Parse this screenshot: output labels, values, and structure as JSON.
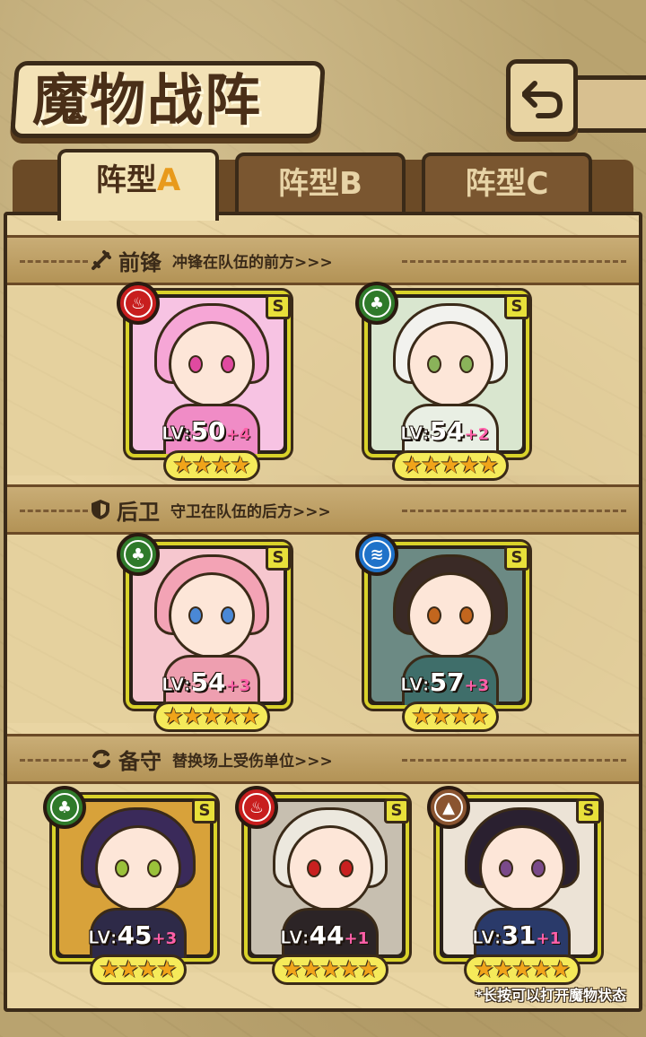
{
  "header": {
    "title": "魔物战阵",
    "back_icon": "return-arrow-icon"
  },
  "tabs": [
    {
      "label_main": "阵型",
      "label_accent": "A",
      "active": true
    },
    {
      "label_main": "阵型",
      "label_accent": "B",
      "active": false
    },
    {
      "label_main": "阵型",
      "label_accent": "C",
      "active": false
    }
  ],
  "sections": {
    "vanguard": {
      "name": "前锋",
      "desc": "冲锋在队伍的前方>>>",
      "icon": "sword-icon"
    },
    "rearguard": {
      "name": "后卫",
      "desc": "守卫在队伍的后方>>>",
      "icon": "shield-icon"
    },
    "reserve": {
      "name": "备守",
      "desc": "替换场上受伤单位>>>",
      "icon": "swap-icon"
    }
  },
  "lv_prefix": "LV:",
  "grade_label": "S",
  "characters": [
    {
      "slot": "vanguard-1",
      "element": "fire",
      "level": "50",
      "plus": "+4",
      "stars": 4,
      "hair": "#f6a6d6",
      "art": "#f7c3e3",
      "body": "#f08cc6",
      "eye": "#e04aa0"
    },
    {
      "slot": "vanguard-2",
      "element": "wood",
      "level": "54",
      "plus": "+2",
      "stars": 5,
      "hair": "#f2f2ee",
      "art": "#d9e6cf",
      "body": "#e9efe4",
      "eye": "#8ab35a"
    },
    {
      "slot": "rearguard-1",
      "element": "wood",
      "level": "54",
      "plus": "+3",
      "stars": 5,
      "hair": "#f3a3b5",
      "art": "#f6c7cf",
      "body": "#ee9fb0",
      "eye": "#4a88d6"
    },
    {
      "slot": "rearguard-2",
      "element": "water",
      "level": "57",
      "plus": "+3",
      "stars": 4,
      "hair": "#3a2a26",
      "art": "#6c8a84",
      "body": "#3f6e6a",
      "eye": "#c2661e"
    },
    {
      "slot": "reserve-1",
      "element": "wood",
      "level": "45",
      "plus": "+3",
      "stars": 4,
      "hair": "#3a2a5a",
      "art": "#d8a23a",
      "body": "#2e2a48",
      "eye": "#9ac13a"
    },
    {
      "slot": "reserve-2",
      "element": "fire",
      "level": "44",
      "plus": "+1",
      "stars": 5,
      "hair": "#ece8de",
      "art": "#c7bfb0",
      "body": "#2c2426",
      "eye": "#c82020"
    },
    {
      "slot": "reserve-3",
      "element": "earth",
      "level": "31",
      "plus": "+1",
      "stars": 5,
      "hair": "#2a2030",
      "art": "#ece3d6",
      "body": "#2a3a6a",
      "eye": "#7a4a8a"
    }
  ],
  "footer_note": "*长按可以打开魔物状态"
}
